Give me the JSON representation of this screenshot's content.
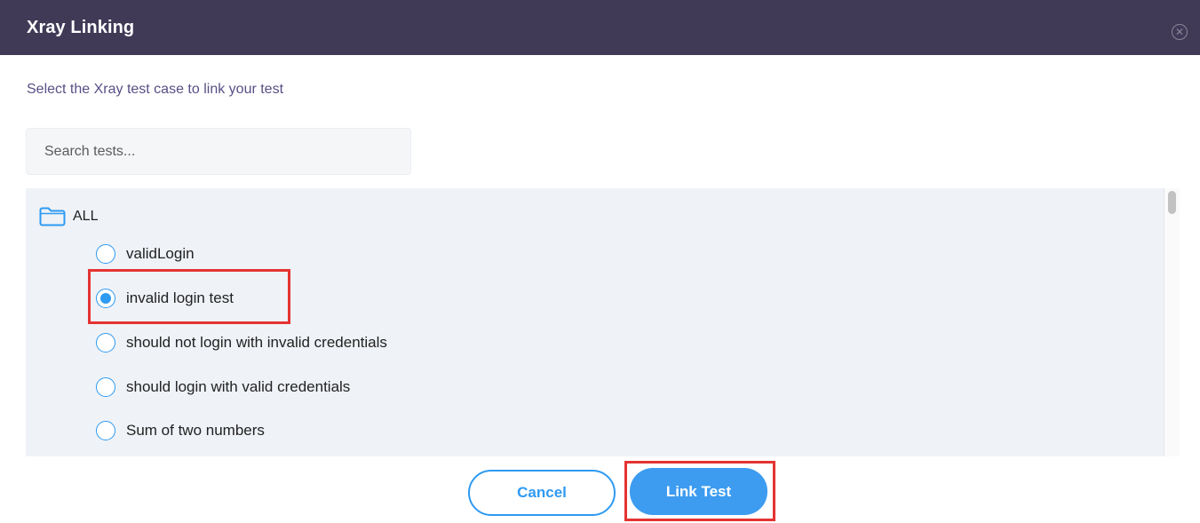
{
  "dialog": {
    "title": "Xray Linking",
    "instruction": "Select the Xray test case to link your test"
  },
  "search": {
    "placeholder": "Search tests..."
  },
  "tree": {
    "folder_label": "ALL",
    "selected_index": 1,
    "items": [
      {
        "label": "validLogin",
        "selected": false
      },
      {
        "label": "invalid login test",
        "selected": true
      },
      {
        "label": "should not login with invalid credentials",
        "selected": false
      },
      {
        "label": "should login with valid credentials",
        "selected": false
      },
      {
        "label": "Sum of two numbers",
        "selected": false
      }
    ]
  },
  "buttons": {
    "cancel_label": "Cancel",
    "link_label": "Link Test"
  },
  "colors": {
    "header_bg": "#403a57",
    "accent": "#2e9af2",
    "highlight": "#e53333",
    "instruction_text": "#5a4f86"
  }
}
